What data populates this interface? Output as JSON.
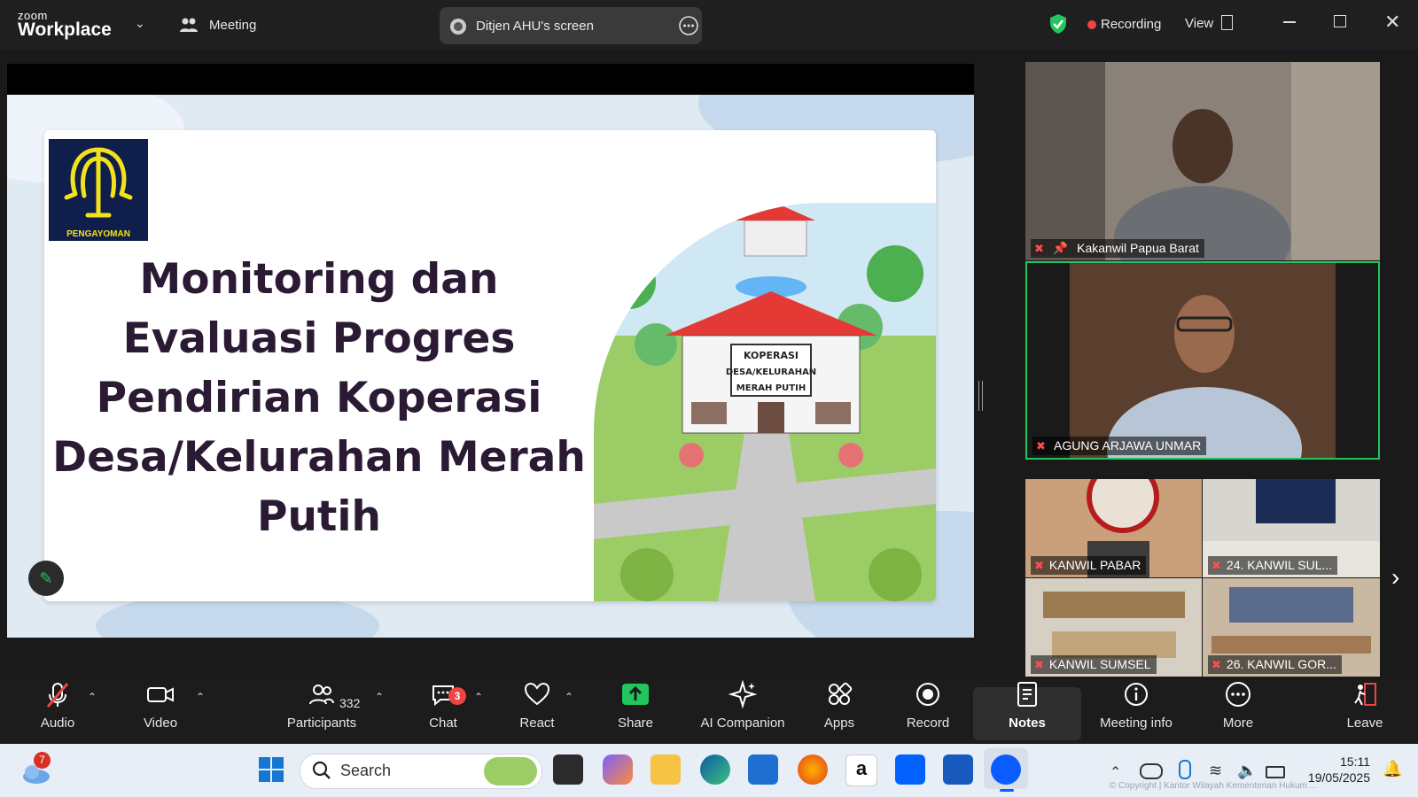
{
  "titlebar": {
    "logo_top": "zoom",
    "logo_bottom": "Workplace",
    "meeting_label": "Meeting",
    "share_label": "Ditjen AHU's screen",
    "recording_label": "Recording",
    "view_label": "View"
  },
  "slide": {
    "logo_caption": "PENGAYOMAN",
    "title_lines": [
      "Monitoring dan",
      "Evaluasi Progres",
      "Pendirian Koperasi",
      "Desa/Kelurahan Merah",
      "Putih"
    ],
    "sign_lines": [
      "KOPERASI",
      "DESA/KELURAHAN",
      "MERAH PUTIH"
    ]
  },
  "participants": {
    "tile1_name": "Kakanwil Papua Barat",
    "tile2_name": "AGUNG ARJAWA UNMAR",
    "grid": [
      "KANWIL PABAR",
      "24. KANWIL SUL...",
      "KANWIL SUMSEL",
      "26. KANWIL GOR..."
    ]
  },
  "toolbar": {
    "audio": "Audio",
    "video": "Video",
    "participants": "Participants",
    "participants_count": "332",
    "chat": "Chat",
    "chat_badge": "3",
    "react": "React",
    "share": "Share",
    "ai": "AI Companion",
    "apps": "Apps",
    "record": "Record",
    "notes": "Notes",
    "info": "Meeting info",
    "more": "More",
    "leave": "Leave"
  },
  "taskbar": {
    "weather_badge": "7",
    "search_placeholder": "Search",
    "time": "15:11",
    "date": "19/05/2025",
    "watermark": "© Copyright | Kantor Wilayah Kementerian Hukum ..."
  },
  "colors": {
    "accent_green": "#22c55e",
    "recording_red": "#ef4444",
    "title_purple": "#2b1a33",
    "logo_navy": "#0f1e4a",
    "logo_yellow": "#f2e21b"
  }
}
